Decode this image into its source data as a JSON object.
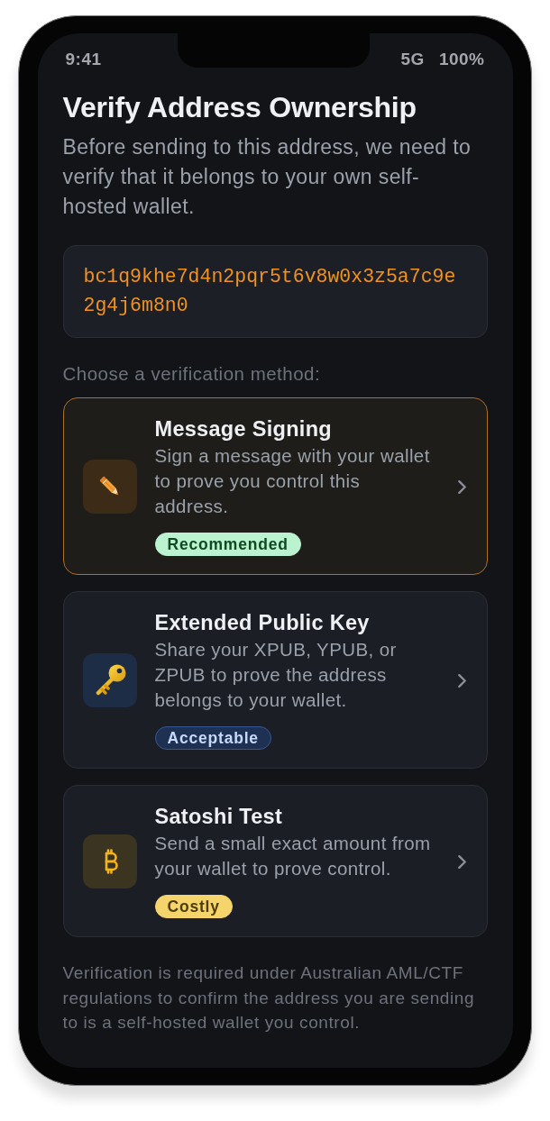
{
  "status_bar": {
    "time": "9:41",
    "network": "5G",
    "battery": "100%"
  },
  "title": "Verify Address Ownership",
  "intro": "Before sending to this address, we need to verify that it belongs to your own self-hosted wallet.",
  "address": "bc1q9khe7d4n2pqr5t6v8w0x3z5a7c9e2g4j6m8n0",
  "methods_label": "Choose a verification method:",
  "methods": [
    {
      "kind": "signing",
      "title": "Message Signing",
      "description": "Sign a message with your wallet to prove you control this address.",
      "badge": {
        "label": "Recommended",
        "color": "#bbf2cf"
      },
      "selected": true
    },
    {
      "kind": "key",
      "title": "Extended Public Key",
      "description": "Share your XPUB, YPUB, or ZPUB to prove the address belongs to your wallet.",
      "badge": {
        "label": "Acceptable",
        "color": "#1e3152"
      },
      "selected": false
    },
    {
      "kind": "coin",
      "title": "Satoshi Test",
      "description": "Send a small exact amount from your wallet to prove control.",
      "badge": {
        "label": "Costly",
        "color": "#f6d46c"
      },
      "selected": false
    }
  ],
  "footnote": "Verification is required under Australian AML/CTF regulations to confirm the address you are sending to is a self-hosted wallet you control."
}
